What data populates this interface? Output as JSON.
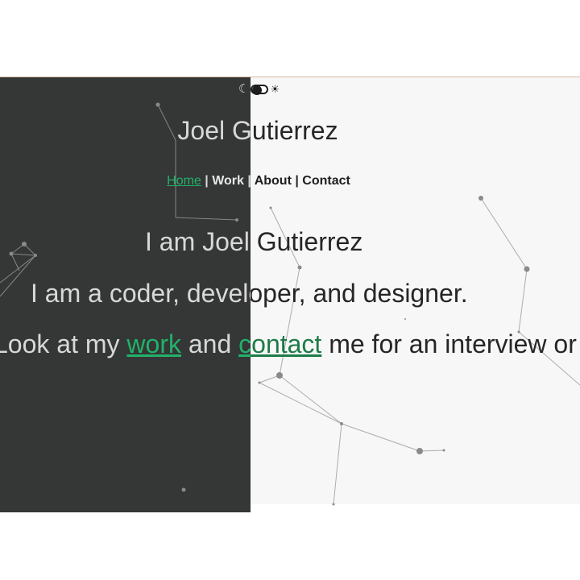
{
  "theme_toggle": {
    "moon_glyph": "☾",
    "sun_glyph": "☀"
  },
  "site": {
    "name": "Joel Gutierrez"
  },
  "nav": {
    "home": "Home",
    "work": "Work",
    "about": "About",
    "contact": "Contact",
    "separator": " | "
  },
  "hero": {
    "line1": "I am Joel Gutierrez",
    "line2": "I am a coder, developer, and designer.",
    "line3_prefix": "Look at my ",
    "line3_work": "work",
    "line3_and": " and ",
    "line3_contact": "contact",
    "line3_suffix": " me for an interview or"
  },
  "colors": {
    "dark_bg": "#343736",
    "light_bg": "#f7f7f7",
    "accent": "#22b26a"
  }
}
